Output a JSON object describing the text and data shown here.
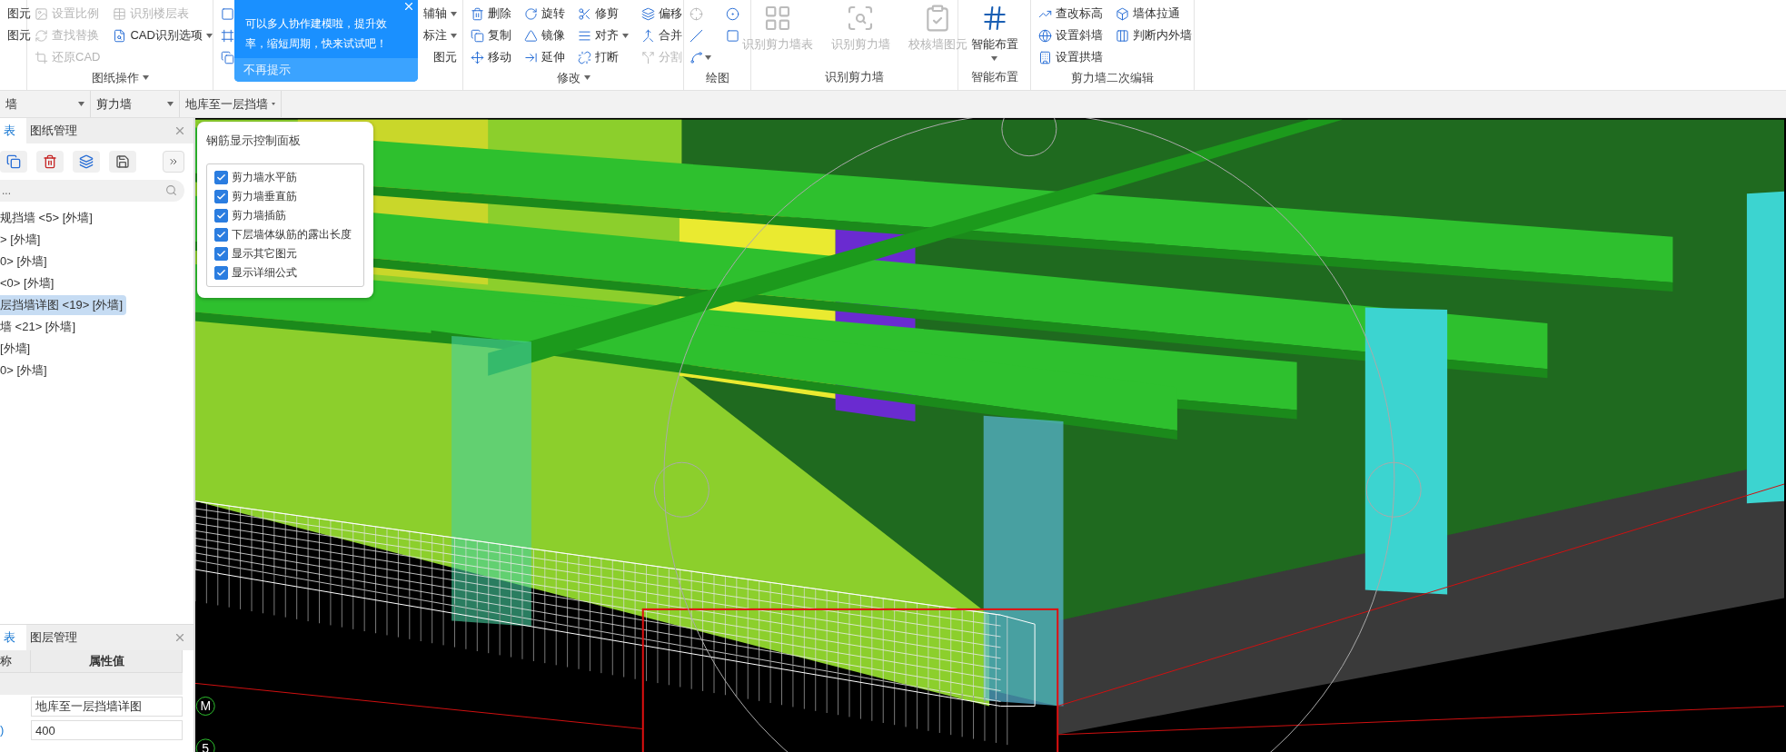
{
  "ribbon": {
    "groups": [
      {
        "kind": "small",
        "items": [
          {
            "label": "图元",
            "disabled": false
          },
          {
            "label": "图元",
            "disabled": false
          }
        ]
      },
      {
        "kind": "small",
        "title": "图纸操作",
        "title_dropdown": true,
        "items": [
          {
            "label": "设置比例",
            "disabled": true
          },
          {
            "label": "查找替换",
            "disabled": true
          },
          {
            "label": "还原CAD",
            "disabled": true
          },
          {
            "label": "识别楼层表",
            "disabled": true
          },
          {
            "label": "CAD识别选项",
            "disabled": false,
            "dropdown": true
          }
        ]
      },
      {
        "kind": "small",
        "items": [
          {
            "disabled": false
          },
          {
            "disabled": false
          },
          {
            "disabled": false
          },
          {
            "label": "辅轴",
            "disabled": false,
            "dropdown": true
          },
          {
            "label": "标注",
            "disabled": false,
            "dropdown": true
          },
          {
            "label": "图元",
            "disabled": false
          }
        ]
      },
      {
        "kind": "small",
        "title": "修改",
        "title_dropdown": true,
        "items": [
          {
            "label": "删除",
            "disabled": false
          },
          {
            "label": "复制",
            "disabled": false
          },
          {
            "label": "移动",
            "disabled": false
          },
          {
            "label": "旋转",
            "disabled": false
          },
          {
            "label": "镜像",
            "disabled": false
          },
          {
            "label": "延伸",
            "disabled": false
          },
          {
            "label": "修剪",
            "disabled": false
          },
          {
            "label": "对齐",
            "disabled": false,
            "dropdown": true
          },
          {
            "label": "打断",
            "disabled": false
          },
          {
            "label": "偏移",
            "disabled": false
          },
          {
            "label": "合并",
            "disabled": false
          },
          {
            "label": "分割",
            "disabled": true
          }
        ]
      },
      {
        "kind": "icons",
        "title": "绘图",
        "items": [
          {
            "disabled": true
          },
          {
            "disabled": false
          },
          {
            "disabled": false,
            "dropdown": true
          },
          {
            "disabled": false
          },
          {
            "disabled": false
          }
        ]
      },
      {
        "kind": "large",
        "title": "识别剪力墙",
        "items": [
          {
            "label": "识别剪力墙表",
            "disabled": true
          },
          {
            "label": "识别剪力墙",
            "disabled": true
          },
          {
            "label": "校核墙图元",
            "disabled": true
          }
        ]
      },
      {
        "kind": "large",
        "title": "智能布置",
        "items": [
          {
            "label": "智能布置",
            "disabled": false,
            "dropdown": true
          }
        ]
      },
      {
        "kind": "small",
        "title": "剪力墙二次编辑",
        "items": [
          {
            "label": "查改标高",
            "disabled": false
          },
          {
            "label": "设置斜墙",
            "disabled": false
          },
          {
            "label": "设置拱墙",
            "disabled": false
          },
          {
            "label": "墙体拉通",
            "disabled": false
          },
          {
            "label": "判断内外墙",
            "disabled": false
          }
        ]
      }
    ]
  },
  "popup": {
    "message": "可以多人协作建模啦，提升效率，缩短周期，快来试试吧！",
    "dismiss": "不再提示"
  },
  "selectors": [
    {
      "value": "墙"
    },
    {
      "value": "剪力墙"
    },
    {
      "value": "地库至一层挡墙"
    }
  ],
  "left_panel": {
    "tabs": [
      {
        "label": "表",
        "selected": true
      },
      {
        "label": "图纸管理",
        "selected": false
      }
    ],
    "search": {
      "placeholder": "..."
    },
    "tree": [
      {
        "label": "规挡墙 <5> [外墙]",
        "selected": false
      },
      {
        "label": "> [外墙]",
        "selected": false
      },
      {
        "label": "0> [外墙]",
        "selected": false
      },
      {
        "label": "<0> [外墙]",
        "selected": false
      },
      {
        "label": "层挡墙详图 <19> [外墙]",
        "selected": true
      },
      {
        "label": "墙 <21> [外墙]",
        "selected": false
      },
      {
        "label": "[外墙]",
        "selected": false
      },
      {
        "label": "0> [外墙]",
        "selected": false
      }
    ]
  },
  "properties_panel": {
    "tabs": [
      {
        "label": "表",
        "selected": true
      },
      {
        "label": "图层管理",
        "selected": false
      }
    ],
    "columns": [
      "称",
      "属性值"
    ],
    "rows": [
      {
        "kind": "section"
      },
      {
        "kind": "field",
        "value": "地库至一层挡墙详图"
      },
      {
        "kind": "field",
        "name": ")",
        "value": "400"
      }
    ]
  },
  "rebar_panel": {
    "title": "钢筋显示控制面板",
    "options": [
      {
        "label": "剪力墙水平筋",
        "checked": true
      },
      {
        "label": "剪力墙垂直筋",
        "checked": true
      },
      {
        "label": "剪力墙插筋",
        "checked": true
      },
      {
        "label": "下层墙体纵筋的露出长度",
        "checked": true
      },
      {
        "label": "显示其它图元",
        "checked": true
      },
      {
        "label": "显示详细公式",
        "checked": true
      }
    ]
  },
  "viewport": {
    "axis_labels": [
      "M",
      "5"
    ]
  }
}
